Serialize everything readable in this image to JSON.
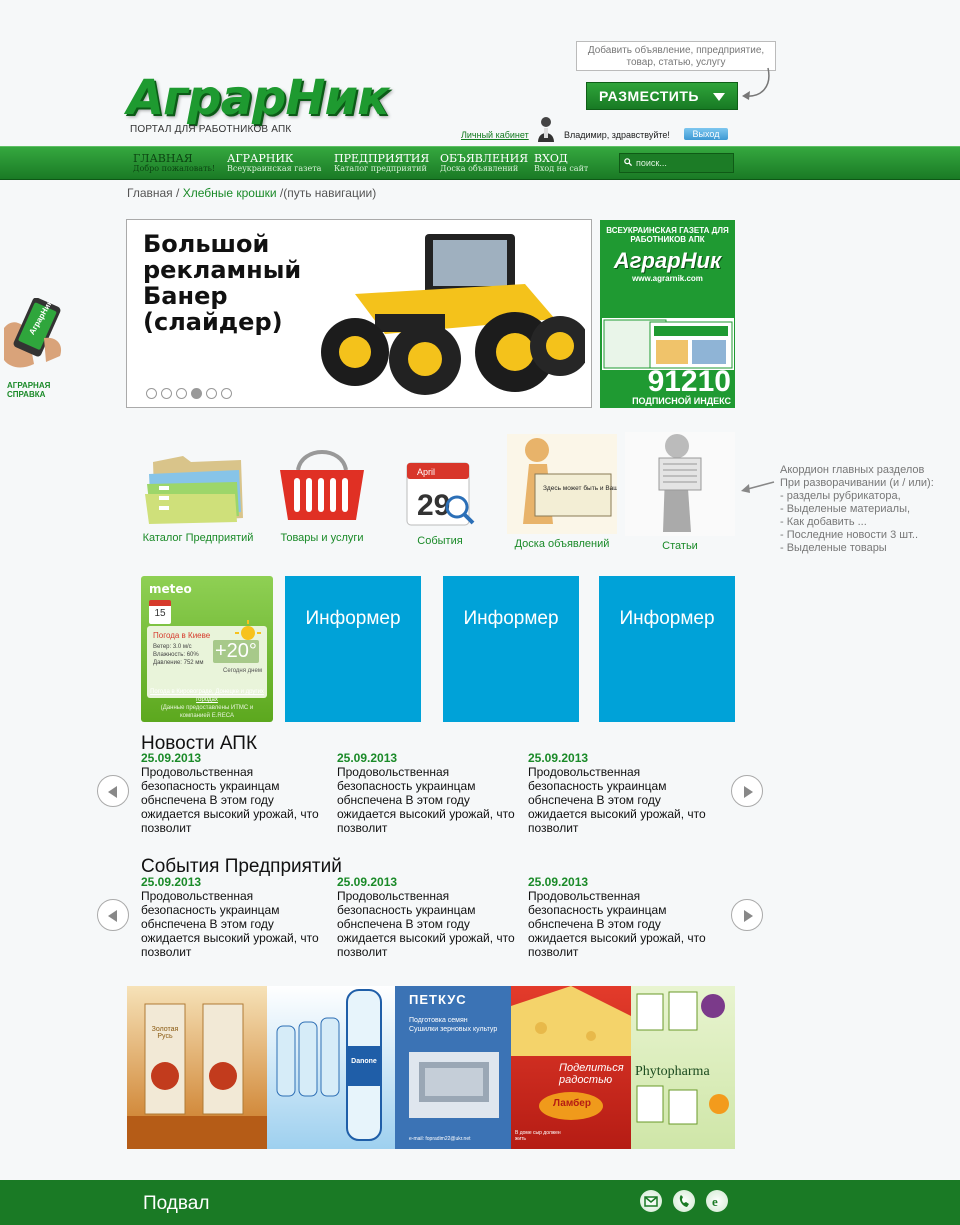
{
  "header": {
    "logo_text": "АграрНик",
    "tagline": "ПОРТАЛ ДЛЯ РАБОТНИКОВ АПК",
    "tooltip": "Добавить объявление, ппредприятие, товар, статью, услугу",
    "place_button": "РАЗМЕСТИТЬ",
    "cabinet_link": "Личный кабинет",
    "greeting": "Владимир, здравствуйте!",
    "logout": "Выход"
  },
  "nav": {
    "items": [
      {
        "title": "ГЛАВНАЯ",
        "subtitle": "Добро пожаловать!"
      },
      {
        "title": "АГРАРНИК",
        "subtitle": "Всеукраинская газета"
      },
      {
        "title": "ПРЕДПРИЯТИЯ",
        "subtitle": "Каталог предприятий"
      },
      {
        "title": "ОБЪЯВЛЕНИЯ",
        "subtitle": "Доска объявлений"
      },
      {
        "title": "ВХОД",
        "subtitle": "Вход на сайт"
      }
    ],
    "search_placeholder": "поиск..."
  },
  "breadcrumb": {
    "home": "Главная",
    "sep1": " / ",
    "crumbs": "Хлебные крошки",
    "rest": " /(путь навигации)"
  },
  "banner": {
    "text": "Большой\nрекламный\nБанер\n(слайдер)",
    "active_slide": 4,
    "slide_count": 6
  },
  "side_ad": {
    "top": "ВСЕУКРАИНСКАЯ ГАЗЕТА ДЛЯ РАБОТНИКОВ АПК",
    "brand": "АграрНик",
    "url": "www.agrarnik.com",
    "number": "91210",
    "index_label": "ПОДПИСНОЙ ИНДЕКС"
  },
  "side_help": {
    "label_line1": "АГРАРНАЯ",
    "label_line2": "СПРАВКА",
    "phone_text": "АграрНик"
  },
  "sections": [
    {
      "label": "Каталог Предприятий",
      "icon": "folders-icon"
    },
    {
      "label": "Товары и услуги",
      "icon": "basket-icon"
    },
    {
      "label": "События",
      "icon": "calendar-icon"
    },
    {
      "label": "Доска объявлений",
      "icon": "board-icon"
    },
    {
      "label": "Статьи",
      "icon": "newspaper-icon"
    }
  ],
  "sections_extra": {
    "calendar_month": "April",
    "calendar_day": "29",
    "board_text": "Здесь может быть и Ваше Объявление"
  },
  "annotation": "Акордион главных разделов\nПри разворачивании (и / или):\n- разделы рубрикатора,\n- Выделеные материалы,\n- Как добавить ...\n- Последние новости 3 шт..\n- Выделеные товары",
  "meteo": {
    "logo": "meteo",
    "day_name": "Чт",
    "day": "15",
    "city": "Погода в Киеве",
    "details": "Ветер: 3.0 м/с\nВлажность: 60%\nДавление: 752 мм",
    "temp": "+20°",
    "today": "Сегодня днем",
    "links": "Погода в Кировограде, Донецке и других городах",
    "credits": "(Данные предоставлены ИТМС и компанией E.RECA"
  },
  "informers": [
    "Информер",
    "Информер",
    "Информер"
  ],
  "news": {
    "title": "Новости АПК",
    "items": [
      {
        "date": "25.09.2013",
        "text": "Продовольственная безопасность украинцам обнспечена В этом году ожидается высокий урожай, что позволит"
      },
      {
        "date": "25.09.2013",
        "text": "Продовольственная безопасность украинцам обнспечена В этом году ожидается высокий урожай, что позволит"
      },
      {
        "date": "25.09.2013",
        "text": "Продовольственная безопасность украинцам обнспечена В этом году ожидается высокий урожай, что позволит"
      }
    ]
  },
  "events": {
    "title": "События Предприятий",
    "items": [
      {
        "date": "25.09.2013",
        "text": "Продовольственная безопасность украинцам обнспечена В этом году ожидается высокий урожай, что позволит"
      },
      {
        "date": "25.09.2013",
        "text": "Продовольственная безопасность украинцам обнспечена В этом году ожидается высокий урожай, что позволит"
      },
      {
        "date": "25.09.2013",
        "text": "Продовольственная безопасность украинцам обнспечена В этом году ожидается высокий урожай, что позволит"
      }
    ]
  },
  "ads": [
    {
      "text": "Золотая Русь"
    },
    {
      "text": "Danone"
    },
    {
      "text": "ПЕТКУС",
      "sub": "Подготовка семян\nСушилки зерновых культур",
      "foot": "e-mail: fopradim22@ukr.net"
    },
    {
      "text": "Поделиться радостью",
      "brand": "Ламбер",
      "foot": "В доме сыр должен жить"
    },
    {
      "text": "Phytopharma"
    }
  ],
  "footer": {
    "label": "Подвал"
  },
  "colors": {
    "brand_green": "#1a7a25",
    "informer_blue": "#00a2d8",
    "date_green": "#1a8a28"
  }
}
